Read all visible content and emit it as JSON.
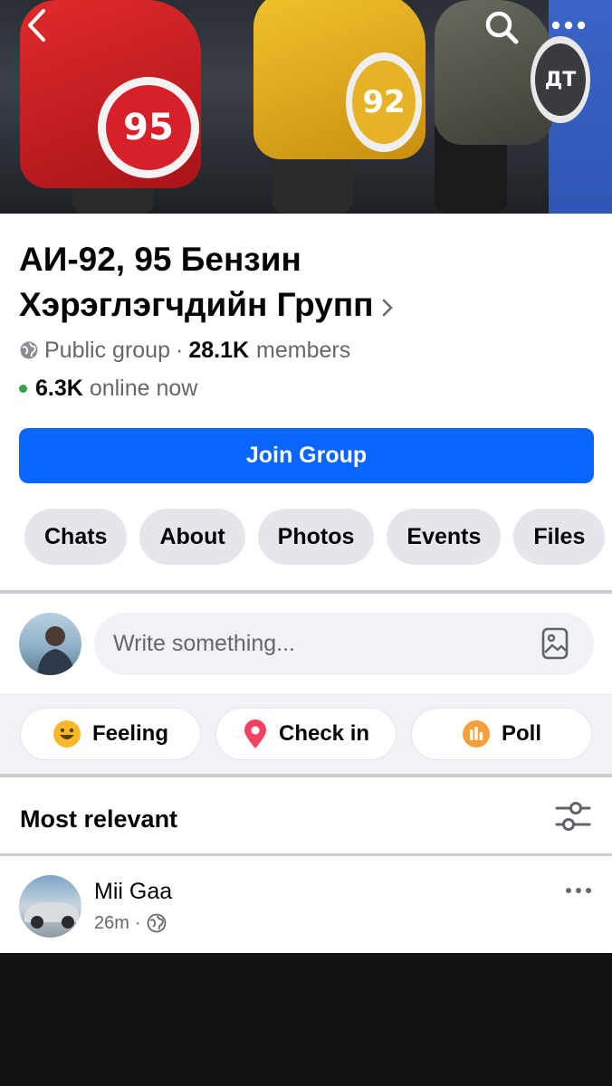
{
  "group": {
    "title_line1": "АИ-92, 95 Бензин",
    "title_line2": "Хэрэглэгчдийн Групп",
    "privacy": "Public group",
    "separator": "·",
    "members_count": "28.1K",
    "members_label": "members",
    "online_count": "6.3K",
    "online_label": "online now",
    "join_label": "Join Group"
  },
  "cover": {
    "badges": [
      "95",
      "92",
      "ДТ"
    ]
  },
  "tabs": [
    "Chats",
    "About",
    "Photos",
    "Events",
    "Files"
  ],
  "composer": {
    "placeholder": "Write something..."
  },
  "actions": {
    "feeling": "Feeling",
    "checkin": "Check in",
    "poll": "Poll"
  },
  "feed": {
    "sort_label": "Most relevant",
    "post": {
      "author": "Mii Gaa",
      "time": "26m",
      "separator": "·"
    }
  },
  "colors": {
    "accent": "#0866ff",
    "online": "#31a24c",
    "chip_bg": "#e4e6eb",
    "muted_text": "#65676b"
  },
  "icons": [
    "back-icon",
    "search-icon",
    "more-icon",
    "globe-icon",
    "chevron-right-icon",
    "photo-icon",
    "feeling-icon",
    "location-pin-icon",
    "poll-icon",
    "filter-icon"
  ]
}
